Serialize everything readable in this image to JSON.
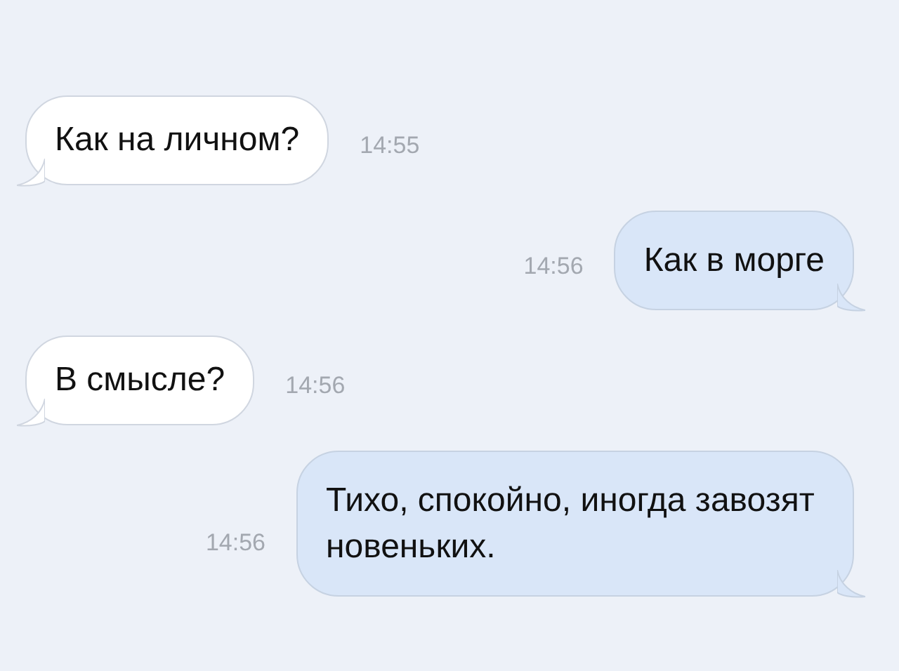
{
  "messages": [
    {
      "kind": "incoming",
      "text": "Как на личном?",
      "time": "14:55"
    },
    {
      "kind": "outgoing",
      "text": "Как в морге",
      "time": "14:56"
    },
    {
      "kind": "incoming",
      "text": "В смысле?",
      "time": "14:56"
    },
    {
      "kind": "outgoing",
      "text": "Тихо, спокойно, иногда завозят новеньких.",
      "time": "14:56"
    }
  ]
}
